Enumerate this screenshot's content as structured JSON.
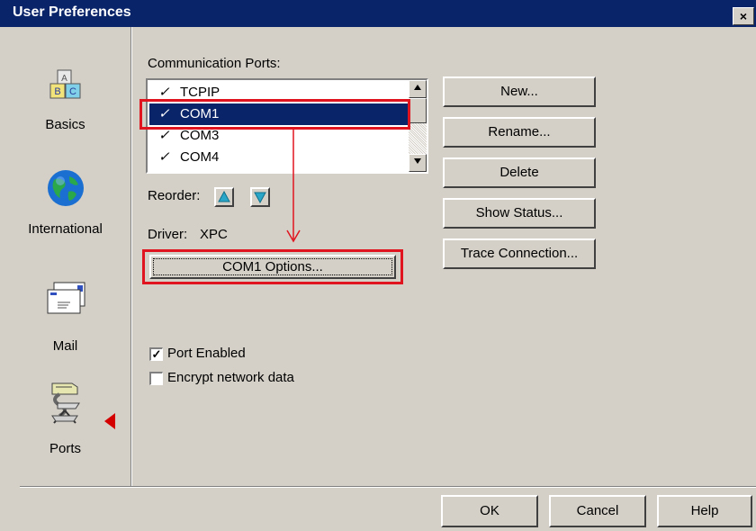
{
  "window": {
    "title": "User Preferences",
    "close_glyph": "×"
  },
  "nav": {
    "items": [
      {
        "label": "Basics",
        "icon": "abc-blocks-icon"
      },
      {
        "label": "International",
        "icon": "globe-icon"
      },
      {
        "label": "Mail",
        "icon": "envelope-icon"
      },
      {
        "label": "Ports",
        "icon": "ports-connector-icon"
      }
    ],
    "selected": "Ports"
  },
  "ports": {
    "label": "Communication Ports:",
    "items": [
      {
        "check": "✓",
        "name": "TCPIP"
      },
      {
        "check": "✓",
        "name": "COM1"
      },
      {
        "check": "✓",
        "name": "COM3"
      },
      {
        "check": "✓",
        "name": "COM4"
      }
    ],
    "selected_index": 1,
    "reorder_label": "Reorder:",
    "driver_label": "Driver:",
    "driver_value": "XPC",
    "options_button": "COM1 Options..."
  },
  "side_buttons": {
    "new": "New...",
    "rename": "Rename...",
    "delete": "Delete",
    "show_status": "Show Status...",
    "trace": "Trace Connection..."
  },
  "checkboxes": {
    "port_enabled": {
      "label": "Port Enabled",
      "checked": true,
      "mark": "✓"
    },
    "encrypt": {
      "label": "Encrypt network data",
      "checked": false
    }
  },
  "footer": {
    "ok": "OK",
    "cancel": "Cancel",
    "help": "Help"
  },
  "colors": {
    "highlight_box": "#e0141e",
    "selection": "#0a246a",
    "dialog_bg": "#d4d0c8"
  }
}
